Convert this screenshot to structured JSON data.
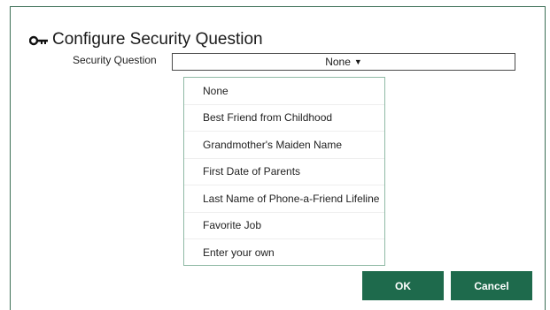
{
  "dialog": {
    "title": "Configure Security Question",
    "title_icon": "key-icon"
  },
  "security_question": {
    "label": "Security Question",
    "selected_value": "None",
    "caret_icon": "caret-down-icon",
    "caret_glyph": "▼"
  },
  "dropdown": {
    "options": [
      "None",
      "Best Friend from Childhood",
      "Grandmother's Maiden Name",
      "First Date of Parents",
      "Last Name of Phone-a-Friend Lifeline",
      "Favorite Job",
      "Enter your own"
    ]
  },
  "buttons": {
    "ok_label": "OK",
    "cancel_label": "Cancel"
  },
  "colors": {
    "button_bg": "#1e6a4c",
    "frame_border": "#3b6e55",
    "dropdown_border": "#8fb9a5"
  }
}
